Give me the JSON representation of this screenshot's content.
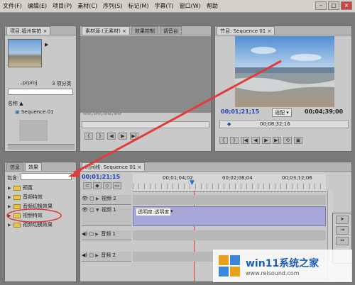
{
  "menu": [
    "文件(F)",
    "编辑(E)",
    "项目(P)",
    "素材(C)",
    "序列(S)",
    "标记(M)",
    "字幕(T)",
    "窗口(W)",
    "帮助"
  ],
  "project_panel": {
    "tab_label": "项目:福州实拍 ×",
    "file_name": "...prproj",
    "item_count": "3 项分类",
    "name_header": "名称",
    "sequence_item": "Sequence 01"
  },
  "source_panel": {
    "tab_source": "素材源:(无素材) ×",
    "tab_effects": "效果控制",
    "timecode": "00;00;00;00",
    "tab_mixer": "调音台"
  },
  "program_panel": {
    "tab_label": "节目: Sequence 01 ×",
    "current_tc": "00;01;21;15",
    "fit": "适配",
    "duration_tc": "00;04;39;00",
    "ruler_tc": "00;08;32;16"
  },
  "effects_panel": {
    "tab_info": "信息",
    "tab_effects": "效果",
    "contains_label": "包含:",
    "items": [
      "预置",
      "音频特效",
      "音频切换效果",
      "视频特效",
      "视频切换效果"
    ]
  },
  "timeline": {
    "tab_label": "时间线: Sequence 01 ×",
    "current_tc": "00;01;21;15",
    "ruler": [
      "00;01;04;02",
      "00;02;08;04",
      "00;03;12;06"
    ],
    "tracks": [
      {
        "label": "视频 2"
      },
      {
        "label": "视频 1",
        "clip": "透明度:透明度"
      },
      {
        "label": "音频 1"
      },
      {
        "label": "音频 2"
      }
    ]
  },
  "watermark": {
    "title": "win11系统之家",
    "url": "www.relsound.com"
  },
  "colors": {
    "accent_red": "#e23b3b",
    "timecode_blue": "#2142b5",
    "clip_purple": "#a8a8d8"
  }
}
